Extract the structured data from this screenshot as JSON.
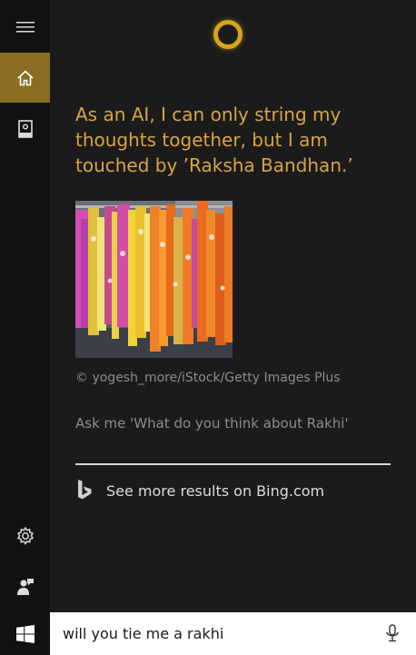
{
  "sidebar": {
    "items": [
      {
        "icon": "hamburger-menu-icon",
        "active": false
      },
      {
        "icon": "home-icon",
        "active": true
      },
      {
        "icon": "notebook-icon",
        "active": false
      }
    ],
    "bottom_items": [
      {
        "icon": "gear-icon"
      },
      {
        "icon": "feedback-icon"
      }
    ]
  },
  "colors": {
    "accent": "#8a6d23",
    "answer_text": "#d9a540",
    "cortana_ring": "#d9a31a"
  },
  "main": {
    "answer_text": "As an AI, I can only string my thoughts together, but I am touched by ’Raksha Bandhan.’",
    "image_credit": "© yogesh_more/iStock/Getty Images Plus",
    "suggestion": "Ask me 'What do you think about Rakhi'",
    "bing_link_label": "See more results on Bing.com"
  },
  "taskbar": {
    "search_value": "will you tie me a rakhi"
  }
}
